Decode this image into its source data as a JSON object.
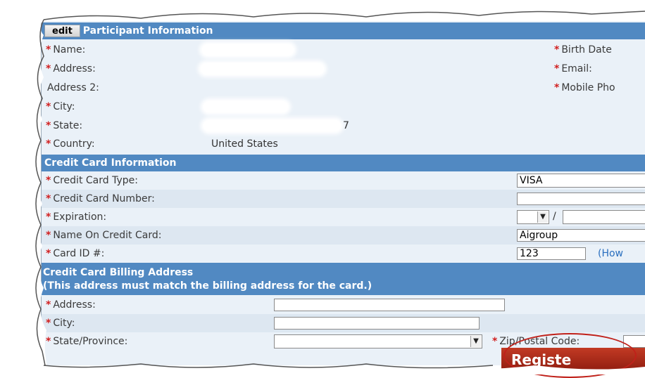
{
  "participant": {
    "edit_label": "edit",
    "title": "Participant Information",
    "name_label": "Name:",
    "address_label": "Address:",
    "address2_label": "Address 2:",
    "city_label": "City:",
    "state_label": "State:",
    "state_partial_value": "7",
    "country_label": "Country:",
    "country_value": "United States",
    "birth_date_label": "Birth Date",
    "email_label": "Email:",
    "mobile_label": "Mobile Pho"
  },
  "credit_card": {
    "title": "Credit Card Information",
    "type_label": "Credit Card Type:",
    "type_value": "VISA",
    "number_label": "Credit Card Number:",
    "expiration_label": "Expiration:",
    "expiration_separator": "/",
    "name_label": "Name On Credit Card:",
    "name_value": "Aigroup",
    "card_id_label": "Card ID #:",
    "card_id_value": "123",
    "how_link": "(How"
  },
  "billing": {
    "title": "Credit Card Billing Address",
    "subtitle": "(This address must match the billing address for the card.)",
    "address_label": "Address:",
    "city_label": "City:",
    "state_label": "State/Province:",
    "zip_label": "Zip/Postal Code:"
  },
  "register_label": "Registe",
  "colors": {
    "header_bar": "#5189c2",
    "required_mark": "#d11f1f",
    "register_button": "#a8281a",
    "panel_bg": "#eaf1f8"
  }
}
